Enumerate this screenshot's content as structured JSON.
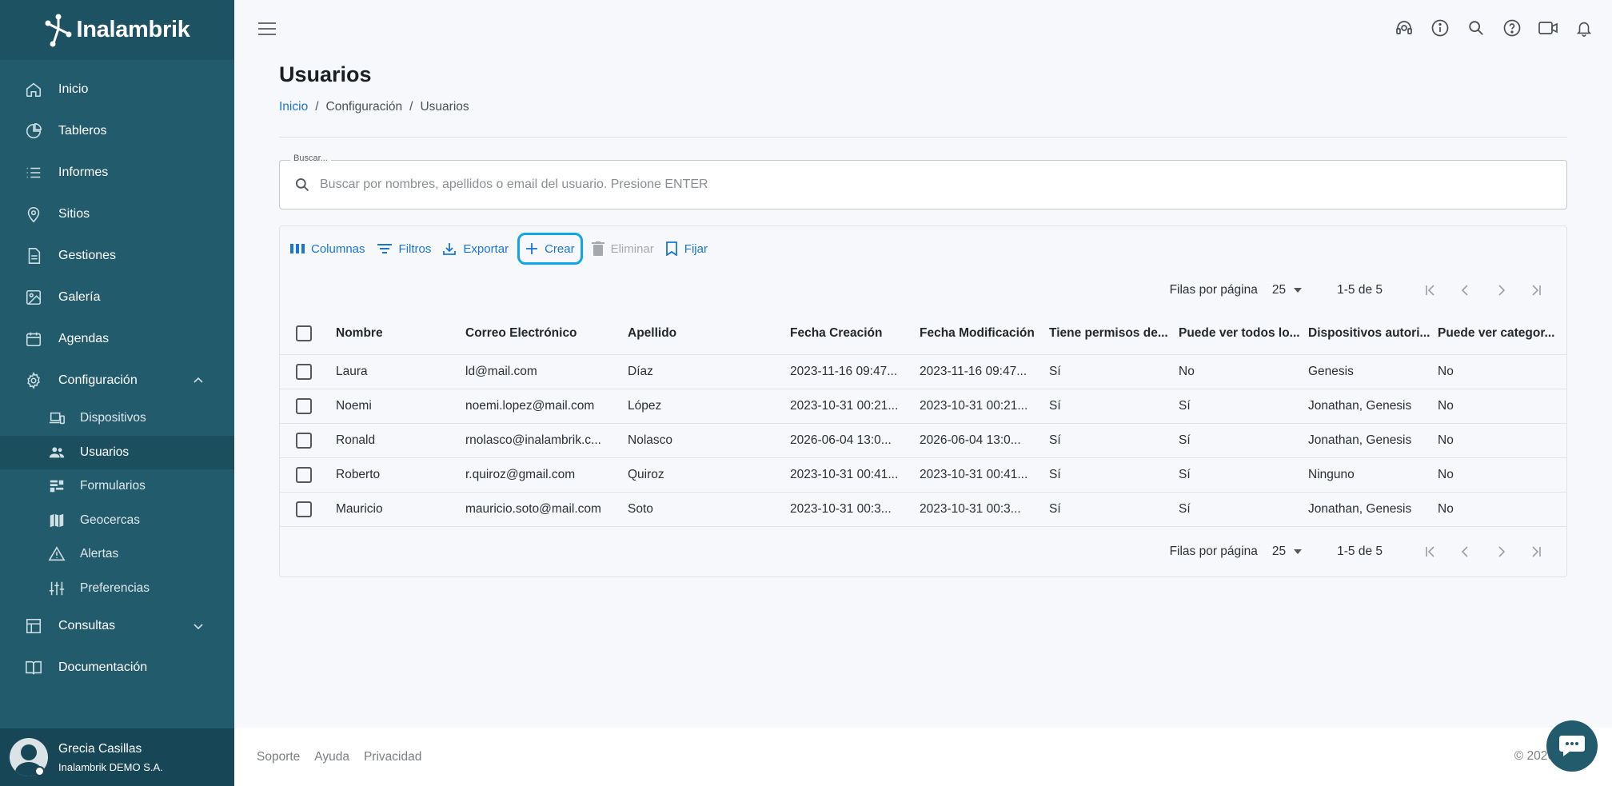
{
  "brand": {
    "name": "Inalambrik"
  },
  "sidebar": {
    "items": [
      {
        "label": "Inicio",
        "icon": "home-icon"
      },
      {
        "label": "Tableros",
        "icon": "pie-chart-icon"
      },
      {
        "label": "Informes",
        "icon": "list-icon"
      },
      {
        "label": "Sitios",
        "icon": "map-pin-icon"
      },
      {
        "label": "Gestiones",
        "icon": "document-icon"
      },
      {
        "label": "Galería",
        "icon": "image-icon"
      },
      {
        "label": "Agendas",
        "icon": "calendar-icon"
      },
      {
        "label": "Configuración",
        "icon": "gear-icon"
      }
    ],
    "config_sub": [
      {
        "label": "Dispositivos",
        "icon": "devices-icon"
      },
      {
        "label": "Usuarios",
        "icon": "users-icon"
      },
      {
        "label": "Formularios",
        "icon": "forms-icon"
      },
      {
        "label": "Geocercas",
        "icon": "map-icon"
      },
      {
        "label": "Alertas",
        "icon": "warning-icon"
      },
      {
        "label": "Preferencias",
        "icon": "sliders-icon"
      }
    ],
    "bottom_items": [
      {
        "label": "Consultas",
        "icon": "table-icon"
      },
      {
        "label": "Documentación",
        "icon": "book-icon"
      }
    ],
    "user": {
      "name": "Grecia Casillas",
      "org": "Inalambrik DEMO S.A."
    }
  },
  "page": {
    "title": "Usuarios",
    "breadcrumb": [
      "Inicio",
      "Configuración",
      "Usuarios"
    ]
  },
  "search": {
    "legend": "Buscar...",
    "placeholder": "Buscar por nombres, apellidos o email del usuario. Presione ENTER"
  },
  "toolbar": {
    "columns": "Columnas",
    "filters": "Filtros",
    "export": "Exportar",
    "create": "Crear",
    "delete": "Eliminar",
    "pin": "Fijar"
  },
  "pager": {
    "rows_label": "Filas por página",
    "rows_value": "25",
    "range": "1-5 de 5"
  },
  "table": {
    "headers": [
      "Nombre",
      "Correo Electrónico",
      "Apellido",
      "Fecha Creación",
      "Fecha Modificación",
      "Tiene permisos de...",
      "Puede ver todos lo...",
      "Dispositivos autori...",
      "Puede ver categor..."
    ],
    "rows": [
      [
        "Laura",
        "ld@mail.com",
        "Díaz",
        "2023-11-16 09:47...",
        "2023-11-16 09:47...",
        "Sí",
        "No",
        "Genesis",
        "No"
      ],
      [
        "Noemi",
        "noemi.lopez@mail.com",
        "López",
        "2023-10-31 00:21...",
        "2023-10-31 00:21...",
        "Sí",
        "Sí",
        "Jonathan, Genesis",
        "No"
      ],
      [
        "Ronald",
        "rnolasco@inalambrik.c...",
        "Nolasco",
        "2026-06-04 13:0...",
        "2026-06-04 13:0...",
        "Sí",
        "Sí",
        "Jonathan, Genesis",
        "No"
      ],
      [
        "Roberto",
        "r.quiroz@gmail.com",
        "Quiroz",
        "2023-10-31 00:41...",
        "2023-10-31 00:41...",
        "Sí",
        "Sí",
        "Ninguno",
        "No"
      ],
      [
        "Mauricio",
        "mauricio.soto@mail.com",
        "Soto",
        "2023-10-31 00:3...",
        "2023-10-31 00:3...",
        "Sí",
        "Sí",
        "Jonathan, Genesis",
        "No"
      ]
    ]
  },
  "footer": {
    "links": [
      "Soporte",
      "Ayuda",
      "Privacidad"
    ],
    "copyright": "© 2026"
  },
  "colors": {
    "sidebar": "#225b6b",
    "accent": "#1976d2",
    "highlight": "#0ea5e9"
  }
}
